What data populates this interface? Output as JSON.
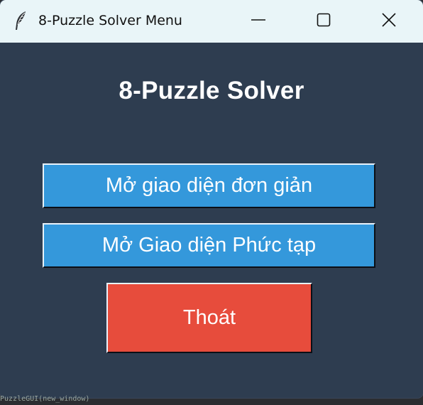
{
  "window": {
    "title": "8-Puzzle Solver Menu",
    "icon": "feather-icon",
    "controls": [
      "minimize-icon",
      "maximize-icon",
      "close-icon"
    ]
  },
  "main": {
    "heading": "8-Puzzle Solver",
    "buttons": {
      "simple": "Mở giao diện đơn giản",
      "complex": "Mở Giao diện Phức tạp",
      "exit": "Thoát"
    }
  },
  "background": {
    "code_snippet": "PuzzleGUI(new_window)"
  },
  "colors": {
    "titlebar": "#e9f5f8",
    "background": "#2e3d50",
    "primary_button": "#3498db",
    "exit_button": "#e74c3c",
    "text": "#ffffff"
  }
}
